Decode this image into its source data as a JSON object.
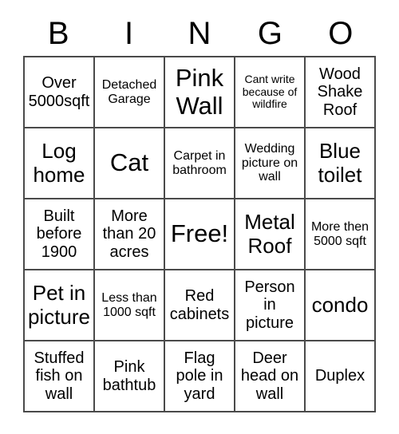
{
  "card": {
    "header_letters": [
      "B",
      "I",
      "N",
      "G",
      "O"
    ],
    "rows": [
      [
        {
          "text": "Over 5000sqft",
          "size": "fs-md"
        },
        {
          "text": "Detached Garage",
          "size": "fs-sm"
        },
        {
          "text": "Pink Wall",
          "size": "fs-xl"
        },
        {
          "text": "Cant write because of wildfire",
          "size": "fs-xs"
        },
        {
          "text": "Wood Shake Roof",
          "size": "fs-md"
        }
      ],
      [
        {
          "text": "Log home",
          "size": "fs-lg"
        },
        {
          "text": "Cat",
          "size": "fs-xl"
        },
        {
          "text": "Carpet in bathroom",
          "size": "fs-sm"
        },
        {
          "text": "Wedding picture on wall",
          "size": "fs-sm"
        },
        {
          "text": "Blue toilet",
          "size": "fs-lg"
        }
      ],
      [
        {
          "text": "Built before 1900",
          "size": "fs-md"
        },
        {
          "text": "More than 20 acres",
          "size": "fs-md"
        },
        {
          "text": "Free!",
          "size": "fs-xl"
        },
        {
          "text": "Metal Roof",
          "size": "fs-lg"
        },
        {
          "text": "More then 5000 sqft",
          "size": "fs-sm"
        }
      ],
      [
        {
          "text": "Pet in picture",
          "size": "fs-lg"
        },
        {
          "text": "Less than 1000 sqft",
          "size": "fs-sm"
        },
        {
          "text": "Red cabinets",
          "size": "fs-md"
        },
        {
          "text": "Person in picture",
          "size": "fs-md"
        },
        {
          "text": "condo",
          "size": "fs-lg"
        }
      ],
      [
        {
          "text": "Stuffed fish on wall",
          "size": "fs-md"
        },
        {
          "text": "Pink bathtub",
          "size": "fs-md"
        },
        {
          "text": "Flag pole in yard",
          "size": "fs-md"
        },
        {
          "text": "Deer head on wall",
          "size": "fs-md"
        },
        {
          "text": "Duplex",
          "size": "fs-md"
        }
      ]
    ],
    "colors": {
      "background": "#ffffff",
      "text": "#000000",
      "grid_line": "#4a4a4a"
    }
  }
}
